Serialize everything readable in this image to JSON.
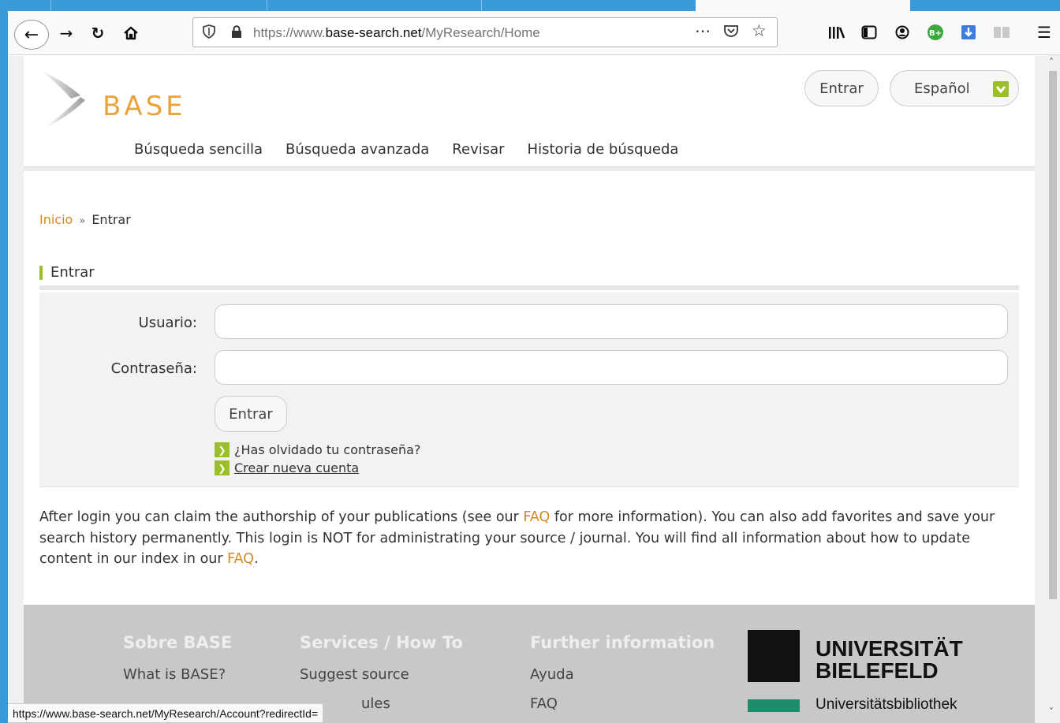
{
  "browser": {
    "url_prefix": "https://www.",
    "url_domain": "base-search.net",
    "url_path": "/MyResearch/Home",
    "status_url": "https://www.base-search.net/MyResearch/Account?redirectId=",
    "icons": {
      "back": "back-arrow-icon",
      "forward": "forward-arrow-icon",
      "reload": "reload-icon",
      "home": "home-icon",
      "shield": "tracking-shield-icon",
      "lock": "lock-icon",
      "more": "more-actions-icon",
      "pocket": "pocket-icon",
      "bookmark": "bookmark-star-icon",
      "library": "library-icon",
      "sidebar": "sidebar-icon",
      "account": "account-icon",
      "extension": "extension-icon",
      "download": "download-icon",
      "reader": "reader-icon",
      "menu": "hamburger-menu-icon"
    },
    "extension_badge": "B+"
  },
  "site": {
    "logo_text": "BASE",
    "login_button": "Entrar",
    "language_button": "Español",
    "nav": [
      "Búsqueda sencilla",
      "Búsqueda avanzada",
      "Revisar",
      "Historia de búsqueda"
    ]
  },
  "breadcrumb": {
    "home": "Inicio",
    "separator": "»",
    "current": "Entrar"
  },
  "login_form": {
    "title": "Entrar",
    "username_label": "Usuario:",
    "username_value": "",
    "password_label": "Contraseña:",
    "password_value": "",
    "submit": "Entrar",
    "forgot_link": "¿Has olvidado tu contraseña?",
    "create_link": "Crear nueva cuenta"
  },
  "info": {
    "part1": "After login you can claim the authorship of your publications (see our ",
    "faq1": "FAQ",
    "part2": " for more information). You can also add favorites and save your search history permanently. This login is NOT for administrating your source / journal. You will find all information about how to update content in our index in our ",
    "faq2": "FAQ",
    "part3": "."
  },
  "footer": {
    "col1_title": "Sobre BASE",
    "col1_items": [
      "What is BASE?"
    ],
    "col2_title": "Services / How To",
    "col2_items": [
      "Suggest source",
      "ules"
    ],
    "col3_title": "Further information",
    "col3_items": [
      "Ayuda",
      "FAQ"
    ],
    "university": "UNIVERSITÄT BIELEFELD",
    "university_line1": "UNIVERSITÄT",
    "university_line2": "BIELEFELD",
    "library": "Universitätsbibliothek"
  },
  "colors": {
    "accent_orange": "#e8a33c",
    "accent_green": "#9bbf2a",
    "link_orange": "#d08a20",
    "footer_bg": "#c8c8c8",
    "browser_blue": "#3b9ad9",
    "uni_green": "#1c8c6b"
  }
}
